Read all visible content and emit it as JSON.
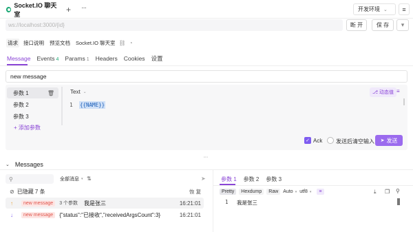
{
  "tab": {
    "title": "Socket.IO 聊天室"
  },
  "header": {
    "plus": "+",
    "more": "···",
    "env_label": "开发环境",
    "menu": "≡"
  },
  "url": {
    "placeholder": "ws://localhost:3000/{id}",
    "disconnect": "断 开",
    "save": "保 存",
    "save_more": "▾"
  },
  "doc": {
    "items": [
      "请求",
      "接口说明",
      "预览文档"
    ],
    "name": "Socket.IO 聊天室"
  },
  "subtabs": [
    {
      "label": "Message",
      "count": ""
    },
    {
      "label": "Events",
      "count": "4"
    },
    {
      "label": "Params",
      "count": "1"
    },
    {
      "label": "Headers",
      "count": ""
    },
    {
      "label": "Cookies",
      "count": ""
    },
    {
      "label": "设置",
      "count": ""
    }
  ],
  "event_name": "new message",
  "params": {
    "items": [
      "参数 1",
      "参数 2",
      "参数 3"
    ],
    "add": "+ 添加参数"
  },
  "editor": {
    "type": "Text",
    "dynamic": "⎇ 动态值",
    "line": "1",
    "code": "{{NAME}}"
  },
  "send": {
    "ack": "Ack",
    "clear": "发送后清空输入",
    "button": "发送"
  },
  "messages": {
    "title": "Messages",
    "filter": "全部消息",
    "hidden": "已隐藏 7 条",
    "restore": "恢 复",
    "rows": [
      {
        "dir": "↑",
        "event": "new message",
        "argc": "3 个参数",
        "content": "我是张三",
        "time": "16:21:01"
      },
      {
        "dir": "↓",
        "event": "new message",
        "argc": "",
        "content": "{\"status\":\"已接收\",\"receivedArgsCount\":3}",
        "time": "16:21:01"
      }
    ]
  },
  "detail": {
    "tabs": [
      "参数 1",
      "参数 2",
      "参数 3"
    ],
    "formats": [
      "Pretty",
      "Hexdump",
      "Raw"
    ],
    "auto": "Auto",
    "encoding": "utf8",
    "line": "1",
    "text": "我是张三"
  },
  "colors": {
    "accent": "#8a45d6",
    "send": "#9b6bee",
    "badge_bg": "#fde6e4",
    "badge_text": "#e0534a",
    "ws_green": "#1aa874"
  }
}
